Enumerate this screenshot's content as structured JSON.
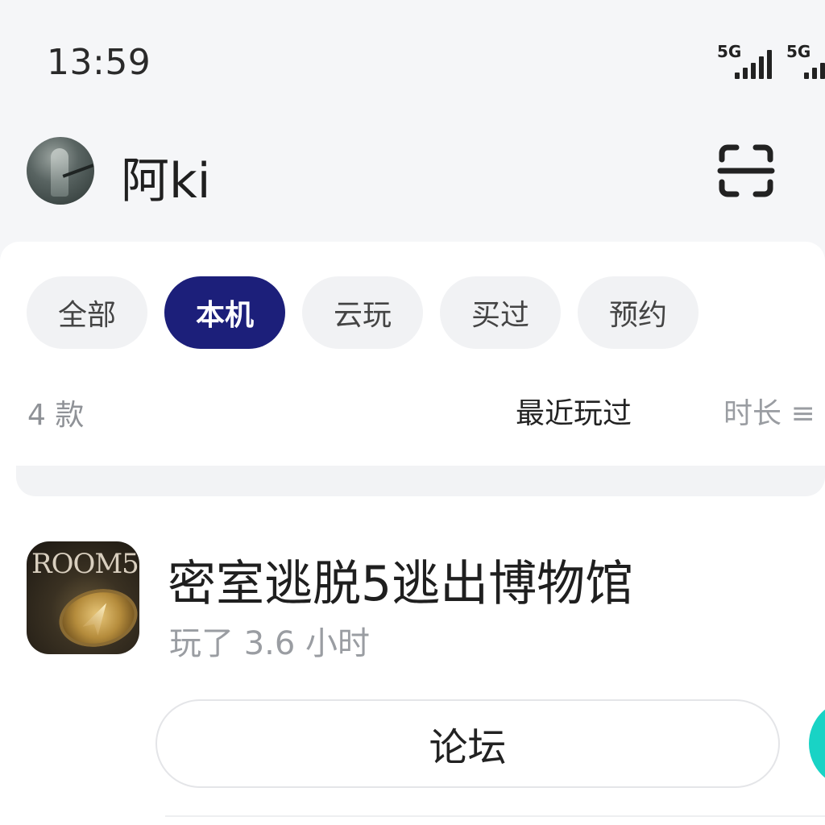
{
  "status_bar": {
    "time": "13:59",
    "signals": [
      "5G",
      "5G"
    ]
  },
  "header": {
    "username": "阿ki",
    "scan_icon": "scan-icon"
  },
  "filters": {
    "chips": [
      {
        "label": "全部",
        "active": false
      },
      {
        "label": "本机",
        "active": true
      },
      {
        "label": "云玩",
        "active": false
      },
      {
        "label": "买过",
        "active": false
      },
      {
        "label": "预约",
        "active": false
      }
    ],
    "count_label": "4 款",
    "sort_recent": "最近玩过",
    "sort_duration": "时长 ≡"
  },
  "games": [
    {
      "icon_text": "ROOM5",
      "title": "密室逃脱5逃出博物馆",
      "playtime": "玩了 3.6 小时",
      "forum_label": "论坛"
    }
  ],
  "colors": {
    "active_chip": "#1c1f7a",
    "teal_accent": "#19d3c5",
    "background": "#f5f6f8"
  }
}
